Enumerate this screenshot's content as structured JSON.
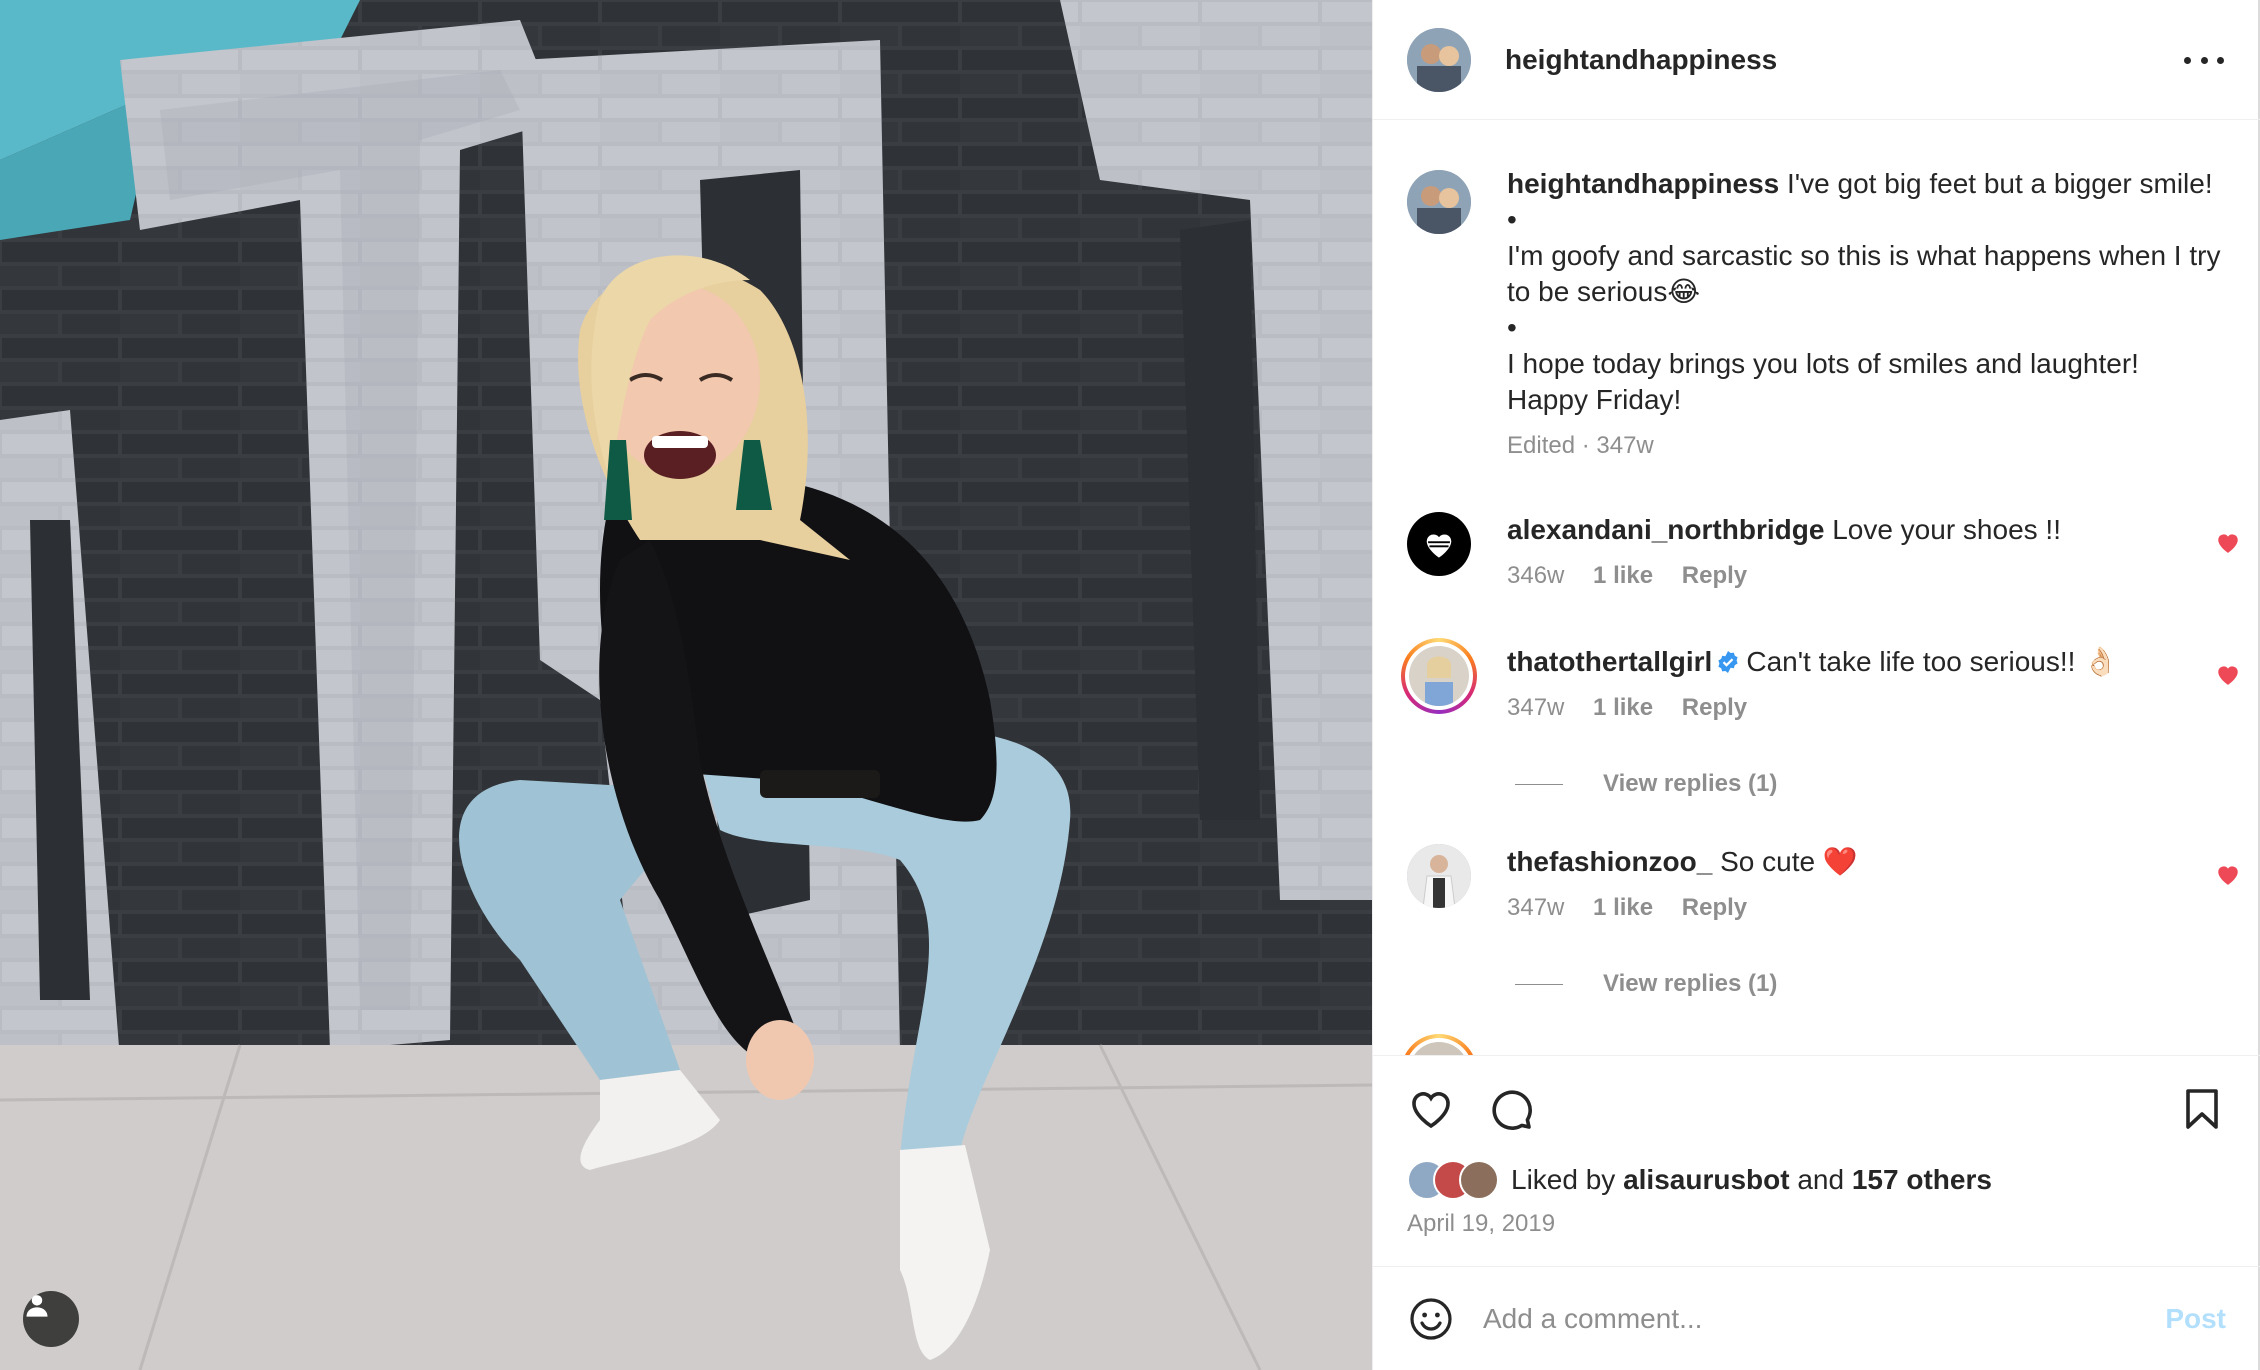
{
  "post": {
    "author": "heightandhappiness",
    "more_icon": "more-horizontal-icon",
    "caption": {
      "username": "heightandhappiness",
      "lines": [
        "I've got big feet but a bigger smile!",
        "•",
        "I'm goofy and sarcastic so this is what happens when I try to be serious😂",
        "•",
        "I hope today brings you lots of smiles and laughter! Happy Friday!"
      ],
      "edited": "Edited · 347w"
    },
    "comments": [
      {
        "username": "alexandani_northbridge",
        "text": "Love your shoes !!",
        "age": "346w",
        "likes": "1 like",
        "reply": "Reply",
        "liked": true
      },
      {
        "username": "thatothertallgirl",
        "verified": true,
        "text": "Can't take life too serious!! 👌🏻",
        "age": "347w",
        "likes": "1 like",
        "reply": "Reply",
        "liked": true,
        "view_replies": "View replies (1)"
      },
      {
        "username": "thefashionzoo_",
        "text": "So cute ❤️",
        "age": "347w",
        "likes": "1 like",
        "reply": "Reply",
        "liked": true,
        "view_replies": "View replies (1)"
      }
    ],
    "likes": {
      "prefix": "Liked by",
      "user": "alisaurusbot",
      "joiner": "and",
      "others": "157 others"
    },
    "date": "April 19, 2019",
    "add_comment": {
      "placeholder": "Add a comment...",
      "post_label": "Post"
    }
  },
  "colors": {
    "liked_heart": "#ed4956",
    "verified": "#3897f0",
    "muted_text": "#8e8e8e",
    "post_disabled": "#b2dffc"
  }
}
